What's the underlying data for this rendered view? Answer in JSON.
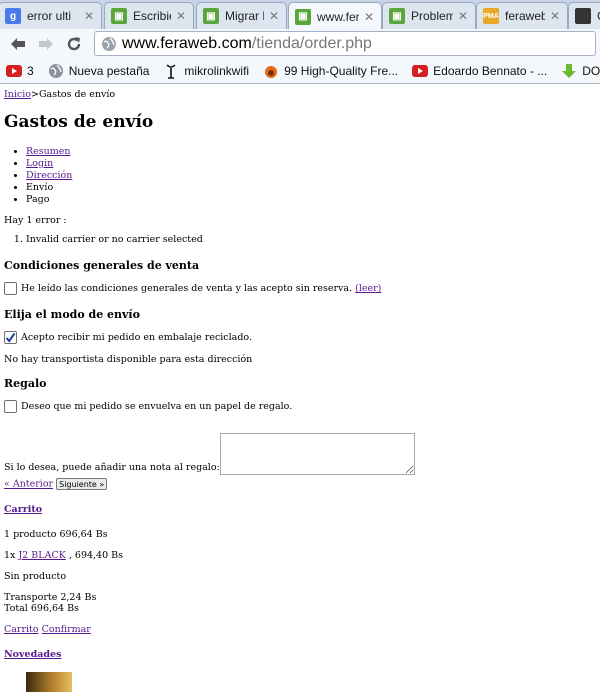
{
  "browser": {
    "tabs": [
      {
        "label": "error ulti",
        "icon": "google-icon",
        "active": false
      },
      {
        "label": "Escribier",
        "icon": "green-leaf-icon",
        "active": false
      },
      {
        "label": "Migrar P",
        "icon": "green-leaf-icon",
        "active": false
      },
      {
        "label": "www.fer",
        "icon": "green-leaf-icon",
        "active": true
      },
      {
        "label": "Problem",
        "icon": "green-leaf-icon",
        "active": false
      },
      {
        "label": "feraweb",
        "icon": "pma-icon",
        "active": false
      },
      {
        "label": "C",
        "icon": "dark-site-icon",
        "active": false
      }
    ],
    "url_host": "www.feraweb.com",
    "url_path": "/tienda/order.php",
    "bookmarks": [
      {
        "label": "3",
        "icon": "youtube-icon"
      },
      {
        "label": "Nueva pestaña",
        "icon": "globe-icon"
      },
      {
        "label": "mikrolinkwifi",
        "icon": "antenna-icon"
      },
      {
        "label": "99 High-Quality Fre...",
        "icon": "fire-icon"
      },
      {
        "label": "Edoardo Bennato - ...",
        "icon": "youtube-icon"
      },
      {
        "label": "DOW",
        "icon": "download-arrow-icon"
      }
    ]
  },
  "page": {
    "breadcrumb": {
      "home": "Inicio",
      "separator": ">",
      "current": "Gastos de envío"
    },
    "title": "Gastos de envío",
    "steps": [
      {
        "label": "Resumen",
        "link": true
      },
      {
        "label": "Login",
        "link": true
      },
      {
        "label": "Dirección",
        "link": true
      },
      {
        "label": "Envío",
        "link": false
      },
      {
        "label": "Pago",
        "link": false
      }
    ],
    "error_count_text": "Hay 1 error :",
    "errors": [
      "Invalid carrier or no carrier selected"
    ],
    "terms": {
      "heading": "Condiciones generales de venta",
      "checkbox_label": "He leído las condiciones generales de venta y las acepto sin reserva.",
      "read_link": "(leer)",
      "checked": false
    },
    "shipping": {
      "heading": "Elija el modo de envío",
      "recycled_label": "Acepto recibir mi pedido en embalaje reciclado.",
      "recycled_checked": true,
      "no_carrier_text": "No hay transportista disponible para esta dirección"
    },
    "gift": {
      "heading": "Regalo",
      "checkbox_label": "Deseo que mi pedido se envuelva en un papel de regalo.",
      "checked": false,
      "note_label": "Si lo desea, puede añadir una nota al regalo:",
      "note_value": ""
    },
    "pager": {
      "prev_label": "« Anterior",
      "next_label": "Siguiente »"
    },
    "cart": {
      "heading": "Carrito",
      "summary": "1 producto 696,64 Bs",
      "item_qty": "1x",
      "item_name": "J2 BLACK",
      "item_price": ", 694,40 Bs",
      "no_product": "Sin producto",
      "shipping": "Transporte 2,24 Bs",
      "total": "Total 696,64 Bs",
      "link_cart": "Carrito",
      "link_confirm": "Confirmar"
    },
    "news_heading": "Novedades"
  }
}
